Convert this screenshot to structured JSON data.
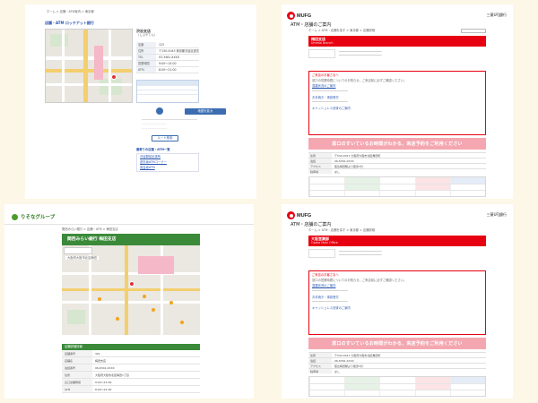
{
  "card1": {
    "breadcrumb": "ホーム > 店舗・ATM案内 > 東京都",
    "title": "店舗・ATM ロッテアット銀行",
    "branch_name": "渋谷支店",
    "branch_kana": "（しぶやてん）",
    "info_rows": [
      {
        "k": "店番",
        "v": "123"
      },
      {
        "k": "住所",
        "v": "〒150-0043 東京都渋谷区道玄坂1丁目"
      },
      {
        "k": "TEL",
        "v": "03-3461-XXXX"
      },
      {
        "k": "営業時間",
        "v": "9:00〜15:00"
      },
      {
        "k": "ATM",
        "v": "8:00〜21:00"
      }
    ],
    "map_button": "地図を拡大",
    "route_button": "ルート検索",
    "nearby_title": "最寄りの店舗・ATM一覧",
    "nearby_items": [
      "渋谷駅前出張所",
      "道玄坂ATMコーナー",
      "宮益坂ATM"
    ]
  },
  "mufg": {
    "logo": "MUFG",
    "bank": "三菱UFJ銀行",
    "page_title": "ATM・店舗のご案内",
    "breadcrumb": "ホーム > ATM・店舗を探す > 東京都 > 店舗詳細",
    "notice_title": "ご来店のお客さまへ",
    "notice_text": "窓口の営業時間についてのお知らせ。ご来店前に必ずご確認ください。",
    "links": [
      "混雑状況のご案内",
      "お手続き・事前受付",
      "キャッシュレス決済のご案内"
    ],
    "banner": "窓口のすいているお時間がわかる、来店予約をご利用ください",
    "table_rows": [
      {
        "k": "住所",
        "v": "〒530-0017 大阪府大阪市北区角田町"
      },
      {
        "k": "電話",
        "v": "06-6361-XXXX"
      },
      {
        "k": "アクセス",
        "v": "阪急梅田駅より徒歩3分"
      },
      {
        "k": "駐車場",
        "v": "なし"
      }
    ]
  },
  "card2": {
    "red_title": "梅田支店",
    "red_sub": "Umeda Branch"
  },
  "card4": {
    "red_title": "大阪営業部",
    "red_sub": "Osaka Main Office"
  },
  "card3": {
    "logo": "りそなグループ",
    "breadcrumb": "関西みらい銀行 > 店舗・ATM > 梅田支店",
    "title": "関西みらい銀行 梅田支店",
    "map_label": "大阪府大阪市北区梅田",
    "section_title": "店舗詳細情報",
    "rows": [
      {
        "k": "店舗番号",
        "v": "301"
      },
      {
        "k": "店舗名",
        "v": "梅田支店"
      },
      {
        "k": "電話番号",
        "v": "06-6341-XXXX"
      },
      {
        "k": "住所",
        "v": "大阪府大阪市北区梅田1丁目"
      },
      {
        "k": "窓口営業時間",
        "v": "9:00〜15:00"
      },
      {
        "k": "ATM",
        "v": "8:00〜21:00"
      },
      {
        "k": "駐車場",
        "v": "なし"
      }
    ]
  }
}
